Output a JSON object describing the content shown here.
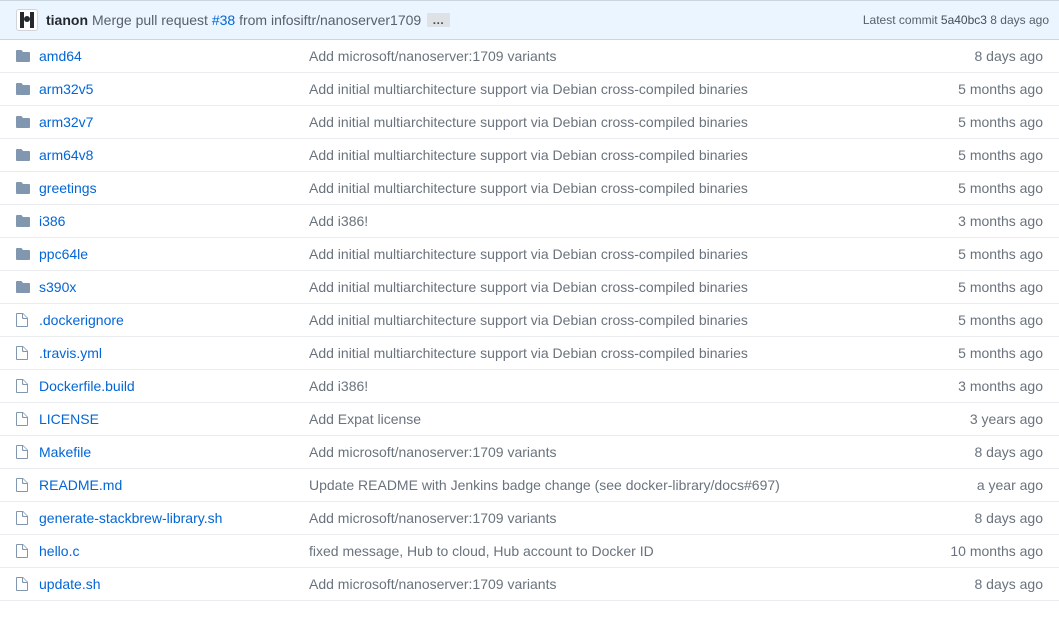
{
  "commitBar": {
    "author": "tianon",
    "messagePrefix": "Merge pull request ",
    "prLink": "#38",
    "messageSuffix": " from infosiftr/nanoserver1709",
    "ellipsis": "…",
    "latestLabel": "Latest commit ",
    "sha": "5a40bc3",
    "timeAgo": " 8 days ago"
  },
  "files": [
    {
      "type": "dir",
      "name": "amd64",
      "msg": "Add microsoft/nanoserver:1709 variants",
      "time": "8 days ago"
    },
    {
      "type": "dir",
      "name": "arm32v5",
      "msg": "Add initial multiarchitecture support via Debian cross-compiled binaries",
      "time": "5 months ago"
    },
    {
      "type": "dir",
      "name": "arm32v7",
      "msg": "Add initial multiarchitecture support via Debian cross-compiled binaries",
      "time": "5 months ago"
    },
    {
      "type": "dir",
      "name": "arm64v8",
      "msg": "Add initial multiarchitecture support via Debian cross-compiled binaries",
      "time": "5 months ago"
    },
    {
      "type": "dir",
      "name": "greetings",
      "msg": "Add initial multiarchitecture support via Debian cross-compiled binaries",
      "time": "5 months ago"
    },
    {
      "type": "dir",
      "name": "i386",
      "msg": "Add i386!",
      "time": "3 months ago"
    },
    {
      "type": "dir",
      "name": "ppc64le",
      "msg": "Add initial multiarchitecture support via Debian cross-compiled binaries",
      "time": "5 months ago"
    },
    {
      "type": "dir",
      "name": "s390x",
      "msg": "Add initial multiarchitecture support via Debian cross-compiled binaries",
      "time": "5 months ago"
    },
    {
      "type": "file",
      "name": ".dockerignore",
      "msg": "Add initial multiarchitecture support via Debian cross-compiled binaries",
      "time": "5 months ago"
    },
    {
      "type": "file",
      "name": ".travis.yml",
      "msg": "Add initial multiarchitecture support via Debian cross-compiled binaries",
      "time": "5 months ago"
    },
    {
      "type": "file",
      "name": "Dockerfile.build",
      "msg": "Add i386!",
      "time": "3 months ago"
    },
    {
      "type": "file",
      "name": "LICENSE",
      "msg": "Add Expat license",
      "time": "3 years ago"
    },
    {
      "type": "file",
      "name": "Makefile",
      "msg": "Add microsoft/nanoserver:1709 variants",
      "time": "8 days ago"
    },
    {
      "type": "file",
      "name": "README.md",
      "msg": "Update README with Jenkins badge change (see docker-library/docs#697)",
      "time": "a year ago"
    },
    {
      "type": "file",
      "name": "generate-stackbrew-library.sh",
      "msg": "Add microsoft/nanoserver:1709 variants",
      "time": "8 days ago"
    },
    {
      "type": "file",
      "name": "hello.c",
      "msg": "fixed message, Hub to cloud, Hub account to Docker ID",
      "time": "10 months ago"
    },
    {
      "type": "file",
      "name": "update.sh",
      "msg": "Add microsoft/nanoserver:1709 variants",
      "time": "8 days ago"
    }
  ]
}
